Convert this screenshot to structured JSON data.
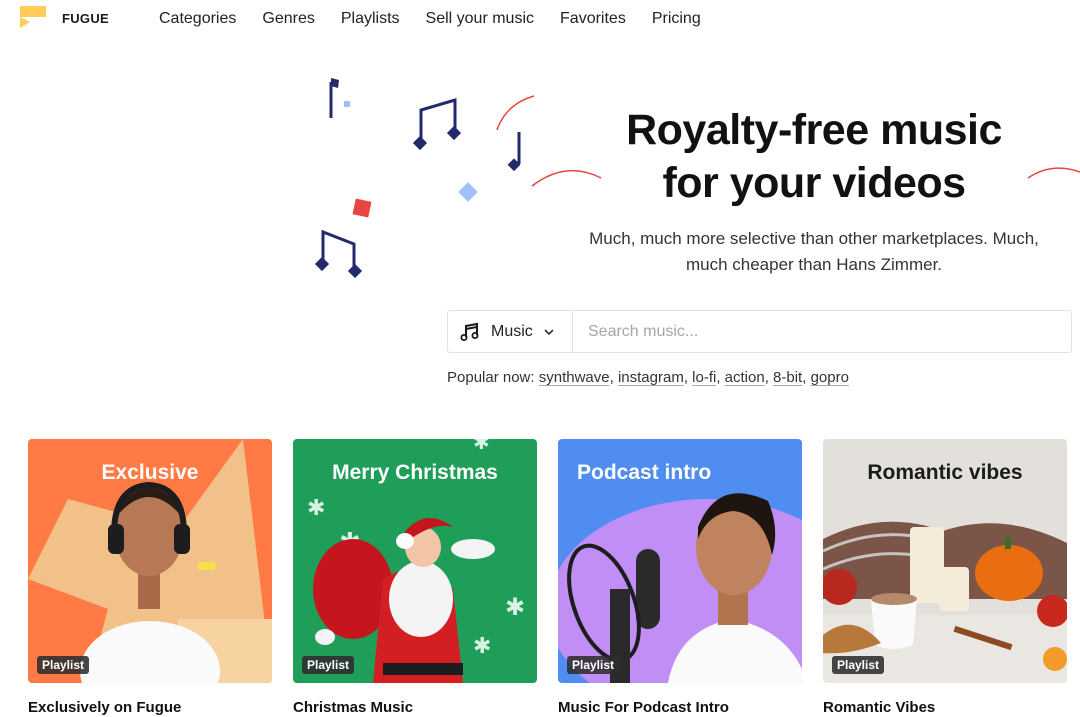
{
  "header": {
    "brand": "FUGUE",
    "nav": [
      "Categories",
      "Genres",
      "Playlists",
      "Sell your music",
      "Favorites",
      "Pricing"
    ]
  },
  "hero": {
    "title_line1": "Royalty-free music",
    "title_line2": "for your videos",
    "subtitle_line1": "Much, much more selective than other marketplaces. Much,",
    "subtitle_line2": "much cheaper than Hans Zimmer."
  },
  "search": {
    "type_label": "Music",
    "placeholder": "Search music..."
  },
  "popular": {
    "label": "Popular now:",
    "tags": [
      "synthwave",
      "instagram",
      "lo-fi",
      "action",
      "8-bit",
      "gopro"
    ]
  },
  "playlists": [
    {
      "thumb_title": "Exclusive",
      "badge": "Playlist",
      "name": "Exclusively on Fugue",
      "bg": "#ff7a45"
    },
    {
      "thumb_title": "Merry Christmas",
      "badge": "Playlist",
      "name": "Christmas Music",
      "bg": "#1f9e5a"
    },
    {
      "thumb_title": "Podcast intro",
      "badge": "Playlist",
      "name": "Music For Podcast Intro",
      "bg": "#4f8df0"
    },
    {
      "thumb_title": "Romantic vibes",
      "badge": "Playlist",
      "name": "Romantic Vibes",
      "bg": "#e3e0dc"
    }
  ],
  "colors": {
    "accent_red": "#e6463f",
    "navy": "#232a6b",
    "light_blue": "#9ec2f5",
    "logo_yellow": "#ffcd57"
  },
  "icons": {
    "logo": "fugue-logo-icon",
    "music": "music-note-icon",
    "dropdown": "chevron-down-icon"
  }
}
